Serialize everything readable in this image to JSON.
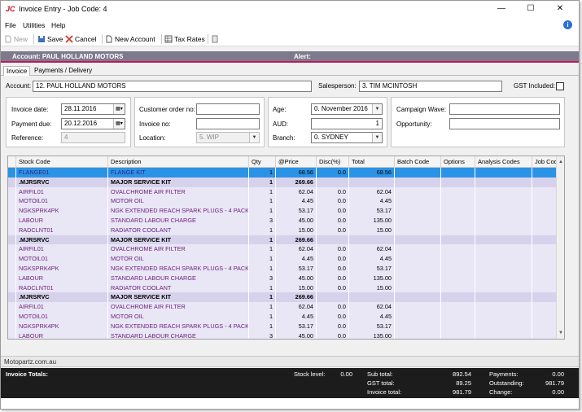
{
  "window": {
    "app_icon": "JC",
    "title": "Invoice Entry - Job Code: 4",
    "minimize": "—",
    "maximize": "☐",
    "close": "✕"
  },
  "menu": {
    "items": [
      "File",
      "Utilities",
      "Help"
    ],
    "info_icon": "i"
  },
  "toolbar": {
    "new_label": "New",
    "save_label": "Save",
    "cancel_label": "Cancel",
    "new_account_label": "New Account",
    "tax_rates_label": "Tax Rates"
  },
  "strip": {
    "account": "Account: PAUL HOLLAND MOTORS",
    "alert": "Alert:"
  },
  "tabs": {
    "invoice": "Invoice",
    "payments": "Payments / Delivery"
  },
  "header": {
    "account_label": "Account:",
    "account_value": "12. PAUL HOLLAND MOTORS",
    "salesperson_label": "Salesperson:",
    "salesperson_value": "3. TIM MCINTOSH",
    "gst_label": "GST Included:"
  },
  "dates": {
    "invoice_date_label": "Invoice date:",
    "invoice_date": "28.11.2016",
    "payment_due_label": "Payment due:",
    "payment_due": "20.12.2016",
    "reference_label": "Reference:",
    "reference": "4"
  },
  "order": {
    "customer_order_label": "Customer order no:",
    "customer_order": "",
    "invoice_no_label": "Invoice no:",
    "invoice_no": "",
    "location_label": "Location:",
    "location": "5. WIP"
  },
  "aging": {
    "age_label": "Age:",
    "age": "0. November 2016",
    "aud_label": "AUD:",
    "aud": "1",
    "branch_label": "Branch:",
    "branch": "0. SYDNEY"
  },
  "campaign": {
    "wave_label": "Campaign Wave:",
    "wave": "",
    "opportunity_label": "Opportunity:",
    "opportunity": ""
  },
  "grid": {
    "columns": [
      "Stock Code",
      "Description",
      "Qty",
      "@Price",
      "Disc(%)",
      "Total",
      "Batch Code",
      "Options",
      "Analysis Codes",
      "Job Code"
    ],
    "rows": [
      {
        "type": "sel",
        "code": "FLANGE01",
        "desc": "FLANGE KIT",
        "qty": "1",
        "price": "68.56",
        "disc": "0.0",
        "total": "68.56"
      },
      {
        "type": "kit",
        "code": ".MJRSRVC",
        "desc": "MAJOR SERVICE KIT",
        "qty": "1",
        "price": "269.66",
        "disc": "",
        "total": ""
      },
      {
        "type": "item",
        "code": "AIRFIL01",
        "desc": "OVALCHROME AIR FILTER",
        "qty": "1",
        "price": "62.04",
        "disc": "0.0",
        "total": "62.04"
      },
      {
        "type": "item",
        "code": "MOTOIL01",
        "desc": "MOTOR OIL",
        "qty": "1",
        "price": "4.45",
        "disc": "0.0",
        "total": "4.45"
      },
      {
        "type": "item",
        "code": "NGKSPRK4PK",
        "desc": "NGK EXTENDED REACH SPARK PLUGS - 4 PACK",
        "qty": "1",
        "price": "53.17",
        "disc": "0.0",
        "total": "53.17"
      },
      {
        "type": "item",
        "code": "LABOUR",
        "desc": "STANDARD LABOUR CHARGE",
        "qty": "3",
        "price": "45.00",
        "disc": "0.0",
        "total": "135.00"
      },
      {
        "type": "item",
        "code": "RADCLNT01",
        "desc": "RADIATOR COOLANT",
        "qty": "1",
        "price": "15.00",
        "disc": "0.0",
        "total": "15.00"
      },
      {
        "type": "kit",
        "code": ".MJRSRVC",
        "desc": "MAJOR SERVICE KIT",
        "qty": "1",
        "price": "269.66",
        "disc": "",
        "total": ""
      },
      {
        "type": "item",
        "code": "AIRFIL01",
        "desc": "OVALCHROME AIR FILTER",
        "qty": "1",
        "price": "62.04",
        "disc": "0.0",
        "total": "62.04"
      },
      {
        "type": "item",
        "code": "MOTOIL01",
        "desc": "MOTOR OIL",
        "qty": "1",
        "price": "4.45",
        "disc": "0.0",
        "total": "4.45"
      },
      {
        "type": "item",
        "code": "NGKSPRK4PK",
        "desc": "NGK EXTENDED REACH SPARK PLUGS - 4 PACK",
        "qty": "1",
        "price": "53.17",
        "disc": "0.0",
        "total": "53.17"
      },
      {
        "type": "item",
        "code": "LABOUR",
        "desc": "STANDARD LABOUR CHARGE",
        "qty": "3",
        "price": "45.00",
        "disc": "0.0",
        "total": "135.00"
      },
      {
        "type": "item",
        "code": "RADCLNT01",
        "desc": "RADIATOR COOLANT",
        "qty": "1",
        "price": "15.00",
        "disc": "0.0",
        "total": "15.00"
      },
      {
        "type": "kit",
        "code": ".MJRSRVC",
        "desc": "MAJOR SERVICE KIT",
        "qty": "1",
        "price": "269.66",
        "disc": "",
        "total": ""
      },
      {
        "type": "item",
        "code": "AIRFIL01",
        "desc": "OVALCHROME AIR FILTER",
        "qty": "1",
        "price": "62.04",
        "disc": "0.0",
        "total": "62.04"
      },
      {
        "type": "item",
        "code": "MOTOIL01",
        "desc": "MOTOR OIL",
        "qty": "1",
        "price": "4.45",
        "disc": "0.0",
        "total": "4.45"
      },
      {
        "type": "item",
        "code": "NGKSPRK4PK",
        "desc": "NGK EXTENDED REACH SPARK PLUGS - 4 PACK",
        "qty": "1",
        "price": "53.17",
        "disc": "0.0",
        "total": "53.17"
      },
      {
        "type": "item",
        "code": "LABOUR",
        "desc": "STANDARD LABOUR CHARGE",
        "qty": "3",
        "price": "45.00",
        "disc": "0.0",
        "total": "135.00"
      }
    ]
  },
  "url": "Motopartz.com.au",
  "totals": {
    "title": "Invoice Totals:",
    "stock_level_label": "Stock level:",
    "stock_level": "0.00",
    "subtotal_label": "Sub total:",
    "subtotal": "892.54",
    "gst_label": "GST total:",
    "gst": "89.25",
    "invoice_total_label": "Invoice total:",
    "invoice_total": "981.79",
    "payments_label": "Payments:",
    "payments": "0.00",
    "outstanding_label": "Outstanding:",
    "outstanding": "981.79",
    "change_label": "Change:",
    "change": "0.00"
  },
  "colors": {
    "accent_strip": "#7d7a8e",
    "accent_line": "#c2185b",
    "row_item": "#e9e6f6",
    "row_kit": "#d7d2ec",
    "row_selected": "#2b93e6",
    "totals_bg": "#1c1c1c"
  }
}
